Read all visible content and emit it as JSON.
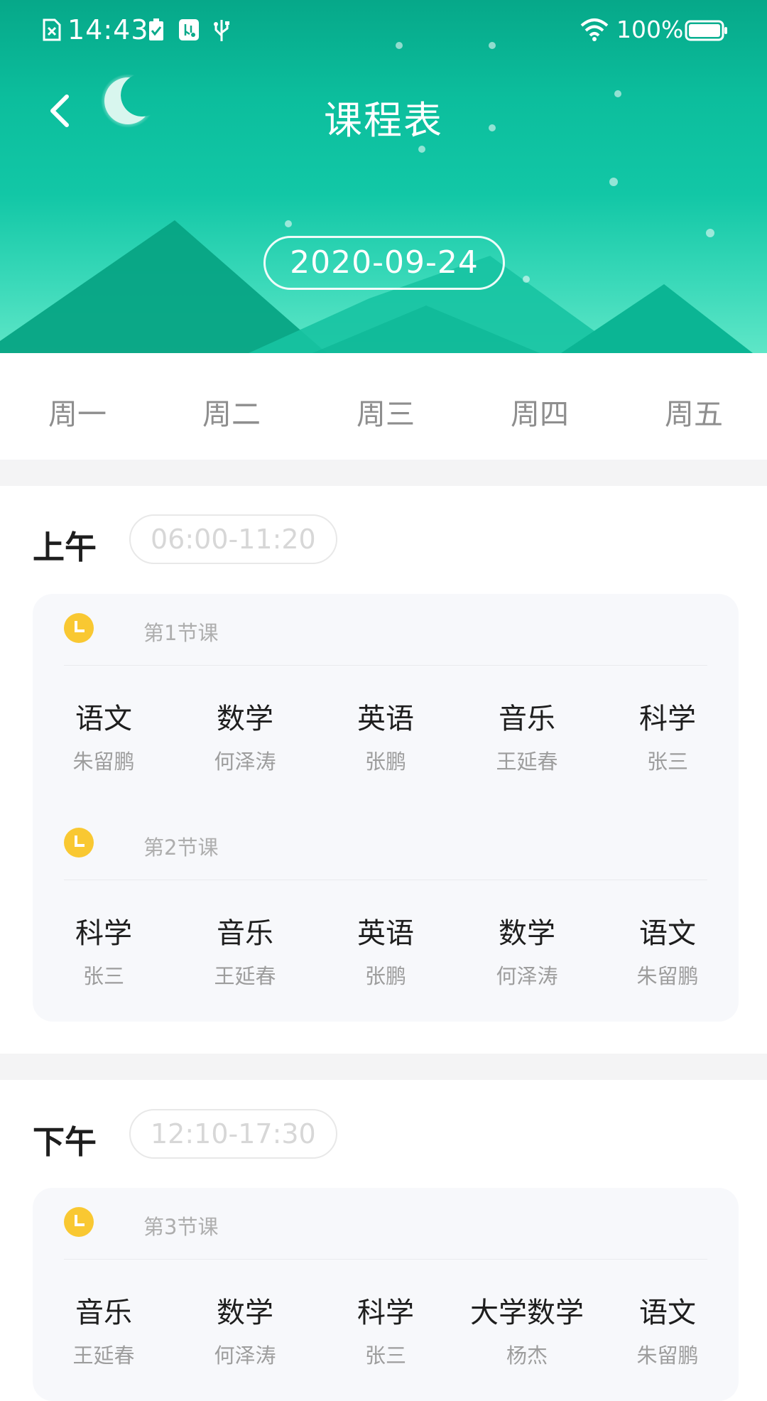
{
  "status_bar": {
    "time": "14:43",
    "battery": "100%"
  },
  "header": {
    "title": "课程表",
    "date": "2020-09-24"
  },
  "colors": {
    "primary": "#0cbe9d",
    "accent_clock": "#f9c832",
    "gap": "#f4f4f5",
    "card": "#f7f8fb"
  },
  "icons": [
    "sim-off-icon",
    "battery-check-icon",
    "usb-debug-icon",
    "usb-icon",
    "wifi-icon",
    "battery-icon",
    "back-arrow-icon",
    "moon-icon",
    "clock-icon"
  ],
  "week_tabs": [
    "周一",
    "周二",
    "周三",
    "周四",
    "周五"
  ],
  "periods": [
    {
      "name": "上午",
      "time": "06:00-11:20",
      "lessons": [
        {
          "label": "第1节课",
          "courses": [
            {
              "name": "语文",
              "teacher": "朱留鹏"
            },
            {
              "name": "数学",
              "teacher": "何泽涛"
            },
            {
              "name": "英语",
              "teacher": "张鹏"
            },
            {
              "name": "音乐",
              "teacher": "王延春"
            },
            {
              "name": "科学",
              "teacher": "张三"
            }
          ]
        },
        {
          "label": "第2节课",
          "courses": [
            {
              "name": "科学",
              "teacher": "张三"
            },
            {
              "name": "音乐",
              "teacher": "王延春"
            },
            {
              "name": "英语",
              "teacher": "张鹏"
            },
            {
              "name": "数学",
              "teacher": "何泽涛"
            },
            {
              "name": "语文",
              "teacher": "朱留鹏"
            }
          ]
        }
      ]
    },
    {
      "name": "下午",
      "time": "12:10-17:30",
      "lessons": [
        {
          "label": "第3节课",
          "courses": [
            {
              "name": "音乐",
              "teacher": "王延春"
            },
            {
              "name": "数学",
              "teacher": "何泽涛"
            },
            {
              "name": "科学",
              "teacher": "张三"
            },
            {
              "name": "大学数学",
              "teacher": "杨杰"
            },
            {
              "name": "语文",
              "teacher": "朱留鹏"
            }
          ]
        }
      ]
    }
  ]
}
